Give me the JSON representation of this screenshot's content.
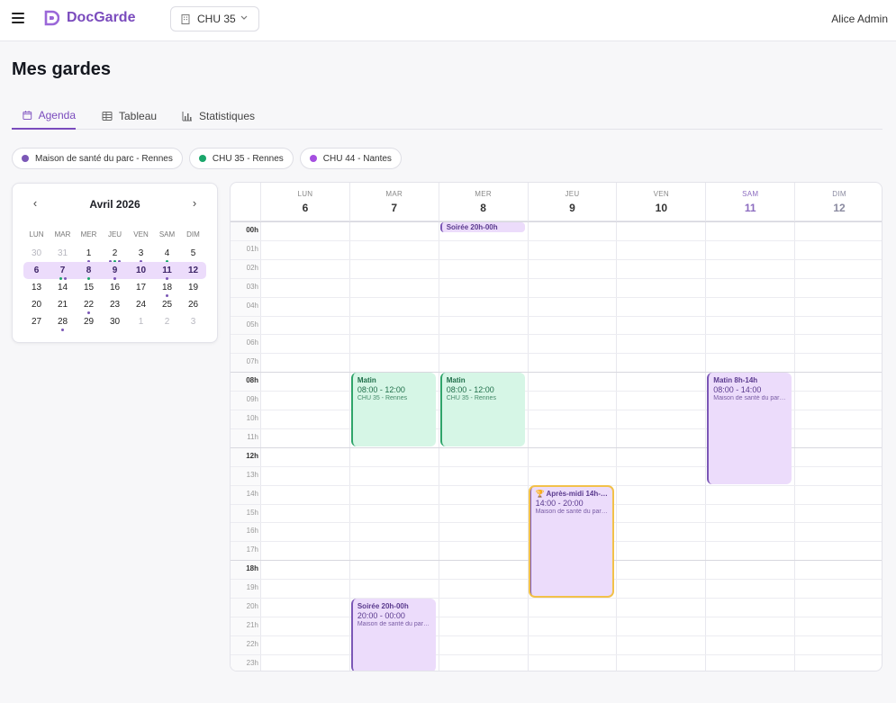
{
  "app": {
    "name": "DocGarde",
    "site": "CHU 35",
    "user": "Alice Admin",
    "brand_color": "#7a4bbd"
  },
  "page": {
    "title": "Mes gardes"
  },
  "tabs": [
    {
      "label": "Agenda",
      "icon": "calendar-icon",
      "active": true
    },
    {
      "label": "Tableau",
      "icon": "table-icon",
      "active": false
    },
    {
      "label": "Statistiques",
      "icon": "bar-chart-icon",
      "active": false
    }
  ],
  "legend": [
    {
      "label": "Maison de santé du parc - Rennes",
      "color": "#7b57b6"
    },
    {
      "label": "CHU 35 - Rennes",
      "color": "#1aa66b"
    },
    {
      "label": "CHU 44 - Nantes",
      "color": "#a54fe0"
    }
  ],
  "mini_calendar": {
    "title": "Avril 2026",
    "prev": "‹",
    "next": "›",
    "dows": [
      "LUN",
      "MAR",
      "MER",
      "JEU",
      "VEN",
      "SAM",
      "DIM"
    ],
    "weeks": [
      [
        {
          "d": "30",
          "m": true
        },
        {
          "d": "31",
          "m": true
        },
        {
          "d": "1",
          "dots": [
            "#7b57b6"
          ]
        },
        {
          "d": "2",
          "dots": [
            "#7b57b6",
            "#1aa66b",
            "#7b57b6"
          ]
        },
        {
          "d": "3",
          "dots": [
            "#7b57b6"
          ]
        },
        {
          "d": "4",
          "dots": [
            "#1aa66b"
          ]
        },
        {
          "d": "5"
        }
      ],
      [
        {
          "d": "6",
          "b": true
        },
        {
          "d": "7",
          "b": true,
          "dots": [
            "#1aa66b",
            "#7b57b6"
          ]
        },
        {
          "d": "8",
          "b": true,
          "dots": [
            "#1aa66b"
          ]
        },
        {
          "d": "9",
          "b": true,
          "dots": [
            "#7b57b6"
          ]
        },
        {
          "d": "10",
          "b": true
        },
        {
          "d": "11",
          "b": true,
          "dots": [
            "#7b57b6"
          ]
        },
        {
          "d": "12",
          "b": true
        }
      ],
      [
        {
          "d": "13"
        },
        {
          "d": "14"
        },
        {
          "d": "15"
        },
        {
          "d": "16"
        },
        {
          "d": "17"
        },
        {
          "d": "18",
          "dots": [
            "#7b57b6"
          ]
        },
        {
          "d": "19"
        }
      ],
      [
        {
          "d": "20"
        },
        {
          "d": "21"
        },
        {
          "d": "22",
          "dots": [
            "#7b57b6"
          ]
        },
        {
          "d": "23"
        },
        {
          "d": "24"
        },
        {
          "d": "25"
        },
        {
          "d": "26"
        }
      ],
      [
        {
          "d": "27"
        },
        {
          "d": "28",
          "dots": [
            "#7b57b6"
          ]
        },
        {
          "d": "29"
        },
        {
          "d": "30"
        },
        {
          "d": "1",
          "m": true
        },
        {
          "d": "2",
          "m": true
        },
        {
          "d": "3",
          "m": true
        }
      ]
    ],
    "selected_week": 1
  },
  "week": {
    "days": [
      {
        "dow": "LUN",
        "num": "6"
      },
      {
        "dow": "MAR",
        "num": "7"
      },
      {
        "dow": "MER",
        "num": "8"
      },
      {
        "dow": "JEU",
        "num": "9"
      },
      {
        "dow": "VEN",
        "num": "10"
      },
      {
        "dow": "SAM",
        "num": "11",
        "weekend": true
      },
      {
        "dow": "DIM",
        "num": "12",
        "sun": true
      }
    ],
    "hours": [
      "00h",
      "01h",
      "02h",
      "03h",
      "04h",
      "05h",
      "06h",
      "07h",
      "08h",
      "09h",
      "10h",
      "11h",
      "12h",
      "13h",
      "14h",
      "15h",
      "16h",
      "17h",
      "18h",
      "19h",
      "20h",
      "21h",
      "22h",
      "23h"
    ],
    "major_hours": [
      "00h",
      "08h",
      "12h",
      "18h"
    ],
    "events": [
      {
        "day": 2,
        "start": 0,
        "end": 0.6,
        "title": "Soirée 20h-00h",
        "color": "purple",
        "bar": true
      },
      {
        "day": 1,
        "start": 8,
        "end": 12,
        "title": "Matin",
        "time": "08:00 - 12:00",
        "place": "CHU 35 - Rennes",
        "color": "green"
      },
      {
        "day": 2,
        "start": 8,
        "end": 12,
        "title": "Matin",
        "time": "08:00 - 12:00",
        "place": "CHU 35 - Rennes",
        "color": "green"
      },
      {
        "day": 5,
        "start": 8,
        "end": 14,
        "title": "Matin 8h-14h",
        "time": "08:00 - 14:00",
        "place": "Maison de santé du parc - Rennes",
        "color": "purple"
      },
      {
        "day": 3,
        "start": 14,
        "end": 20,
        "title": "🏆 Après-midi 14h-20h",
        "time": "14:00 - 20:00",
        "place": "Maison de santé du parc - Rennes",
        "color": "purple",
        "highlight": true
      },
      {
        "day": 1,
        "start": 20,
        "end": 24,
        "title": "Soirée 20h-00h",
        "time": "20:00 - 00:00",
        "place": "Maison de santé du parc - Rennes",
        "color": "purple"
      }
    ]
  }
}
